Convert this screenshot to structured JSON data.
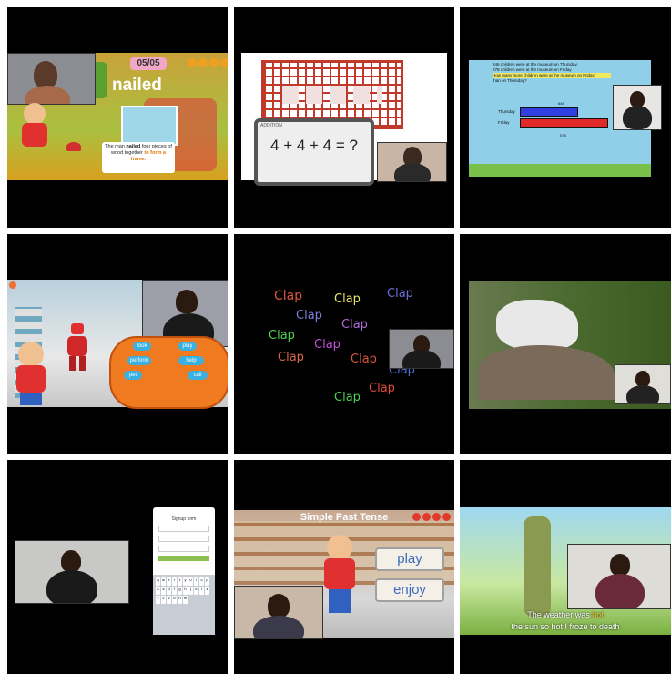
{
  "cell1": {
    "counter": "05/05",
    "word": "nailed",
    "sentence_pre": "The man ",
    "sentence_bold": "nailed",
    "sentence_mid": " four pieces of wood together ",
    "sentence_green": "to form a frame."
  },
  "cell2": {
    "equation": "4 + 4 + 4 = ?",
    "tablet_label": "ADDITION"
  },
  "cell3": {
    "lines": [
      "846 children were at the museum on Thursday.",
      "578 children were at the museum on Friday.",
      "How many more children were at the museum on Friday",
      "than on Thursday?"
    ],
    "bar_labels": [
      "Thursday",
      "Friday"
    ],
    "bar_values": [
      "846",
      "578"
    ]
  },
  "cell4": {
    "buttons": [
      "look",
      "play",
      "perform",
      "help",
      "pet",
      "call"
    ]
  },
  "cell5": {
    "words": [
      {
        "text": "Clap",
        "color": "#d9553a"
      },
      {
        "text": "Clap",
        "color": "#e8e56a"
      },
      {
        "text": "Clap",
        "color": "#6d6fd6"
      },
      {
        "text": "Clap",
        "color": "#7a7fe0"
      },
      {
        "text": "Clap",
        "color": "#b36ad6"
      },
      {
        "text": "Clap",
        "color": "#4fd153"
      },
      {
        "text": "Clap",
        "color": "#c24fd6"
      },
      {
        "text": "Clap",
        "color": "#d96a4a"
      },
      {
        "text": "Clap",
        "color": "#d9553a"
      },
      {
        "text": "Clap",
        "color": "#4f6fd6"
      },
      {
        "text": "Clap",
        "color": "#e04a3a"
      },
      {
        "text": "Clap",
        "color": "#4fd153"
      }
    ]
  },
  "cell7": {
    "form_title": "Signup form",
    "keyboard_keys": [
      "q",
      "w",
      "e",
      "r",
      "t",
      "y",
      "u",
      "i",
      "o",
      "p",
      "a",
      "s",
      "d",
      "f",
      "g",
      "h",
      "j",
      "k",
      "l",
      "z",
      "x",
      "c",
      "v",
      "b",
      "n",
      "m"
    ]
  },
  "cell8": {
    "title": "Simple Past Tense",
    "btn1": "play",
    "btn2": "enjoy"
  },
  "cell9": {
    "subtitle_line1": "The weather was ",
    "subtitle_word": "hot",
    "subtitle_line2": "the sun so hot I froze to death"
  },
  "colors": {
    "cell_bg": "#000000",
    "accent_orange": "#f0a020",
    "accent_red": "#e02a2a"
  }
}
